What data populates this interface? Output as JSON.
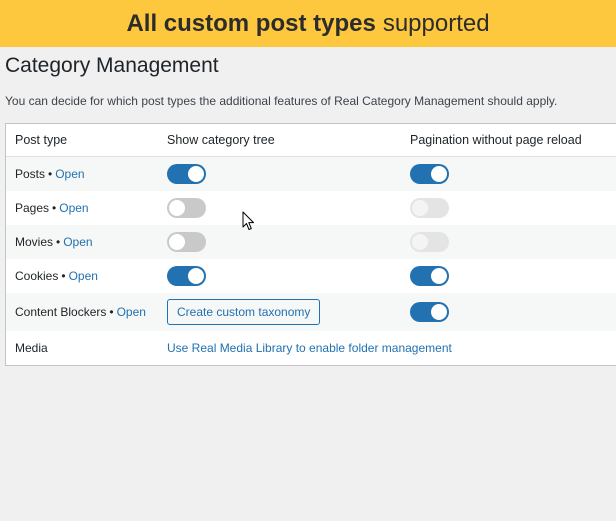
{
  "banner": {
    "bold": "All custom post types",
    "light": "supported"
  },
  "page": {
    "title": "Category Management",
    "description": "You can decide for which post types the additional features of Real Category Management should apply."
  },
  "table": {
    "headers": {
      "post_type": "Post type",
      "category_tree": "Show category tree",
      "pagination": "Pagination without page reload"
    },
    "open_label": "Open",
    "separator": "•",
    "rows": [
      {
        "name": "Posts",
        "tree": "on",
        "pagination": "on"
      },
      {
        "name": "Pages",
        "tree": "off",
        "pagination": "disabled"
      },
      {
        "name": "Movies",
        "tree": "off",
        "pagination": "disabled"
      },
      {
        "name": "Cookies",
        "tree": "on",
        "pagination": "on"
      },
      {
        "name": "Content Blockers",
        "button": "Create custom taxonomy",
        "pagination": "on"
      },
      {
        "name": "Media",
        "link": "Use Real Media Library to enable folder management"
      }
    ]
  },
  "colors": {
    "banner": "#fec83e",
    "accent": "#2271b1",
    "toggle_off": "#c9c9ca",
    "toggle_disabled": "#e4e4e5"
  }
}
